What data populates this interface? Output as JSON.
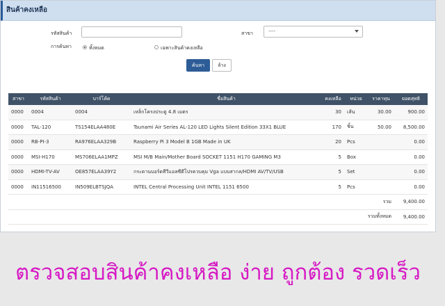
{
  "panel": {
    "title": "สินค้าคงเหลือ"
  },
  "search": {
    "product_code_label": "รหัสสินค้า",
    "product_code_value": "",
    "branch_label": "สาขา",
    "branch_value": "----",
    "search_by_label": "การค้นหา",
    "radio_all_label": "ทั้งหมด",
    "radio_all_checked": true,
    "radio_remaining_label": "เฉพาะสินค้าคงเหลือ",
    "radio_remaining_checked": false,
    "search_button": "ค้นหา",
    "clear_button": "ล้าง"
  },
  "table": {
    "columns": [
      "สาขา",
      "รหัสสินค้า",
      "บาร์โค้ด",
      "ชื่อสินค้า",
      "คงเหลือ",
      "หน่วย",
      "ราคาทุน",
      "ยอดสุทธิ"
    ],
    "rows": [
      [
        "0000",
        "0004",
        "0004",
        "เหล็กโครงประตู 4.8 เมตร",
        "30",
        "เส้น",
        "30.00",
        "900.00"
      ],
      [
        "0000",
        "TAL-120",
        "TS154ELAA480E",
        "Tsunami Air Series AL-120 LED Lights Silent Edition 33X1 BLUE",
        "170",
        "ชิ้น",
        "50.00",
        "8,500.00"
      ],
      [
        "0000",
        "RB-PI-3",
        "RA976ELAA329B",
        "Raspberry Pi 3 Model B 1GB Made in UK",
        "20",
        "Pcs",
        "",
        "0.00"
      ],
      [
        "0000",
        "MSI-H170",
        "MS706ELAA1MPZ",
        "MSI M/B Main/Mother Board SOCKET 1151 H170 GAMING M3",
        "5",
        "Box",
        "",
        "0.00"
      ],
      [
        "0000",
        "HDMI-TV-AV",
        "OE857ELAA39Y2",
        "กระดานบอร์ดทีวีแอลซีดีโปรควบคุม Vga แบบสากล/HDMI AV/TV/USB",
        "5",
        "Set",
        "",
        "0.00"
      ],
      [
        "0000",
        "IN11516500",
        "IN509ELBTSJQA",
        "INTEL Central Processing Unit INTEL 1151 6500",
        "5",
        "Pcs",
        "",
        "0.00"
      ]
    ],
    "subtotal_label": "รวม",
    "subtotal_value": "9,400.00",
    "grandtotal_label": "รวมทั้งหมด",
    "grandtotal_value": "9,400.00"
  },
  "tagline": "ตรวจสอบสินค้าคงเหลือ ง่าย ถูกต้อง รวดเร็ว",
  "colors": {
    "header_bg": "#cfdff0",
    "table_header_bg": "#3f5267",
    "primary_button": "#2d5c97",
    "tagline": "#d619c4"
  }
}
